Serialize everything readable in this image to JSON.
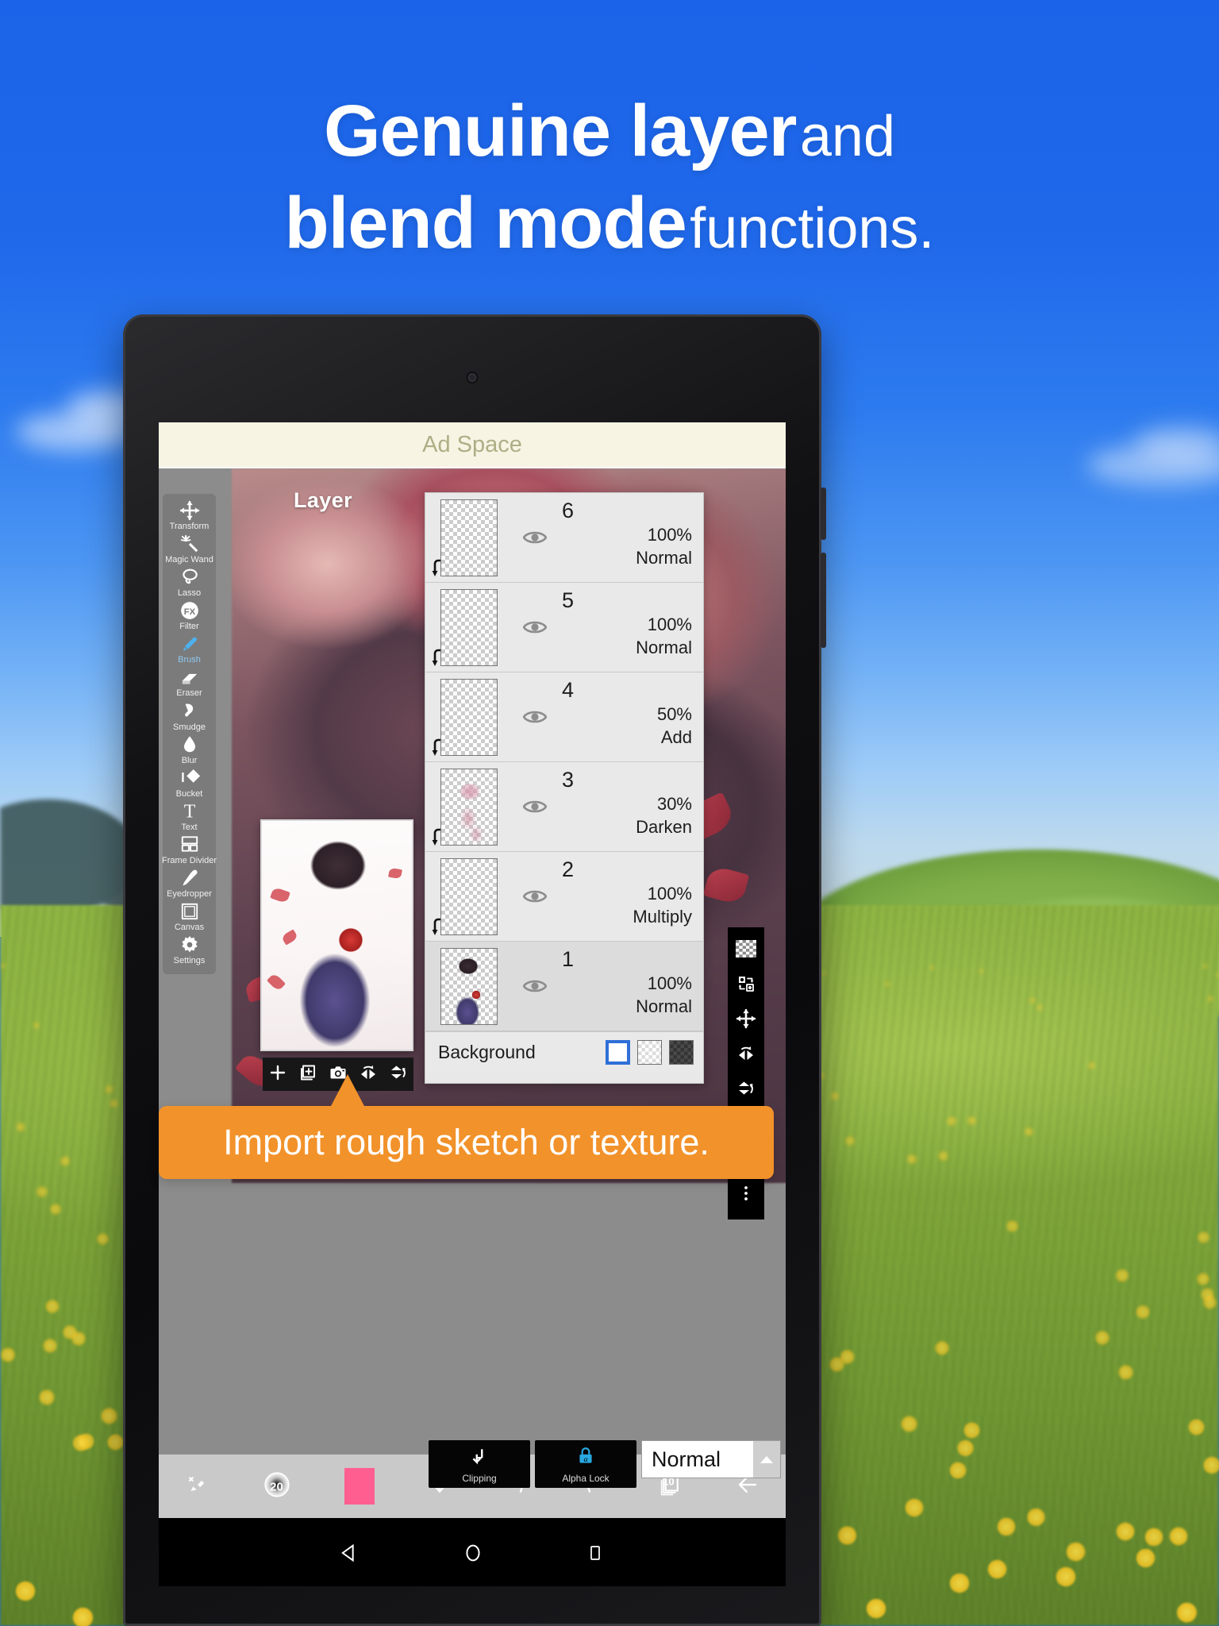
{
  "headline": {
    "line1_bold": "Genuine layer",
    "line1_rest": "and",
    "line2_bold": "blend mode",
    "line2_rest": "functions."
  },
  "callout": {
    "text": "Import rough sketch or texture."
  },
  "app": {
    "ad_bar": {
      "label": "Ad Space"
    },
    "panel_title": "Layer",
    "tools": [
      {
        "label": "Transform",
        "icon": "move-arrows-icon",
        "selected": false
      },
      {
        "label": "Magic Wand",
        "icon": "magic-wand-icon",
        "selected": false
      },
      {
        "label": "Lasso",
        "icon": "lasso-icon",
        "selected": false
      },
      {
        "label": "Filter",
        "icon": "fx-icon",
        "selected": false
      },
      {
        "label": "Brush",
        "icon": "brush-icon",
        "selected": true
      },
      {
        "label": "Eraser",
        "icon": "eraser-icon",
        "selected": false
      },
      {
        "label": "Smudge",
        "icon": "smudge-icon",
        "selected": false
      },
      {
        "label": "Blur",
        "icon": "droplet-icon",
        "selected": false
      },
      {
        "label": "Bucket",
        "icon": "paint-bucket-icon",
        "selected": false
      },
      {
        "label": "Text",
        "icon": "text-t-icon",
        "selected": false
      },
      {
        "label": "Frame Divider",
        "icon": "frame-divider-icon",
        "selected": false
      },
      {
        "label": "Eyedropper",
        "icon": "eyedropper-icon",
        "selected": false
      },
      {
        "label": "Canvas",
        "icon": "canvas-square-icon",
        "selected": false
      },
      {
        "label": "Settings",
        "icon": "gear-icon",
        "selected": false
      }
    ],
    "layer_panel": {
      "layers": [
        {
          "number": "6",
          "opacity": "100%",
          "blend_mode": "Normal",
          "visible": true,
          "clipped": true,
          "thumb": "empty",
          "active": false
        },
        {
          "number": "5",
          "opacity": "100%",
          "blend_mode": "Normal",
          "visible": true,
          "clipped": true,
          "thumb": "empty",
          "active": false
        },
        {
          "number": "4",
          "opacity": "50%",
          "blend_mode": "Add",
          "visible": true,
          "clipped": true,
          "thumb": "empty",
          "active": false
        },
        {
          "number": "3",
          "opacity": "30%",
          "blend_mode": "Darken",
          "visible": true,
          "clipped": true,
          "thumb": "sketch",
          "active": false
        },
        {
          "number": "2",
          "opacity": "100%",
          "blend_mode": "Multiply",
          "visible": true,
          "clipped": true,
          "thumb": "empty",
          "active": false
        },
        {
          "number": "1",
          "opacity": "100%",
          "blend_mode": "Normal",
          "visible": true,
          "clipped": false,
          "thumb": "art",
          "active": true
        }
      ],
      "background_row": {
        "label": "Background",
        "swatches": [
          {
            "name": "white",
            "selected": true
          },
          {
            "name": "light-checker",
            "selected": false
          },
          {
            "name": "dark-checker",
            "selected": false
          }
        ],
        "selected_color": "#ffffff",
        "selection_accent": "#2f6fd8"
      }
    },
    "layer_toolbar": [
      {
        "icon": "plus-icon",
        "name": "add-layer"
      },
      {
        "icon": "duplicate-layer-icon",
        "name": "duplicate-layer"
      },
      {
        "icon": "camera-icon",
        "name": "camera-import"
      },
      {
        "icon": "flip-horizontal-icon",
        "name": "flip-horizontal"
      },
      {
        "icon": "flip-vertical-icon",
        "name": "flip-vertical"
      }
    ],
    "right_rail": [
      {
        "icon": "checkerboard-icon",
        "name": "transparency"
      },
      {
        "icon": "swap-layers-icon",
        "name": "swap-layer"
      },
      {
        "icon": "move-arrows-icon",
        "name": "move-layer"
      },
      {
        "icon": "flip-horizontal-icon",
        "name": "flip-horizontal"
      },
      {
        "icon": "flip-vertical-icon",
        "name": "flip-vertical"
      },
      {
        "icon": "merge-down-icon",
        "name": "merge-down"
      },
      {
        "icon": "trash-icon",
        "name": "delete-layer"
      },
      {
        "icon": "more-vertical-icon",
        "name": "more-options"
      }
    ],
    "bottom_controls": {
      "clipping_label": "Clipping",
      "clipping_icon": "clipping-arrow-icon",
      "alpha_lock_label": "Alpha Lock",
      "alpha_lock_icon": "alpha-lock-icon",
      "blend_mode_value": "Normal",
      "blend_mode_arrow": "chevron-up-icon",
      "accent_color": "#29a8e0"
    },
    "bottom_bar": [
      {
        "icon": "brush-settings-icon",
        "name": "brush-settings",
        "value": ""
      },
      {
        "icon": "brush-size-icon",
        "name": "brush-size",
        "value": "20"
      },
      {
        "icon": "color-chip-icon",
        "name": "color-picker",
        "value": "#ff5f90"
      },
      {
        "icon": "arrow-down-icon",
        "name": "down-tool",
        "value": ""
      },
      {
        "icon": "undo-icon",
        "name": "undo",
        "value": ""
      },
      {
        "icon": "redo-icon",
        "name": "redo",
        "value": ""
      },
      {
        "icon": "layers-stack-icon",
        "name": "layers",
        "value": "10"
      },
      {
        "icon": "back-arrow-icon",
        "name": "back",
        "value": ""
      }
    ],
    "android_nav": [
      {
        "icon": "triangle-back-icon",
        "name": "nav-back"
      },
      {
        "icon": "circle-home-icon",
        "name": "nav-home"
      },
      {
        "icon": "square-recents-icon",
        "name": "nav-recents"
      }
    ]
  },
  "colors": {
    "sky_blue": "#1565e8",
    "callout_orange": "#f2922a",
    "panel_gray": "#e8e8e8",
    "ad_bar_bg": "#f7f4e4",
    "ad_bar_text": "#aeae86",
    "brush_selected": "#4db1f0"
  }
}
